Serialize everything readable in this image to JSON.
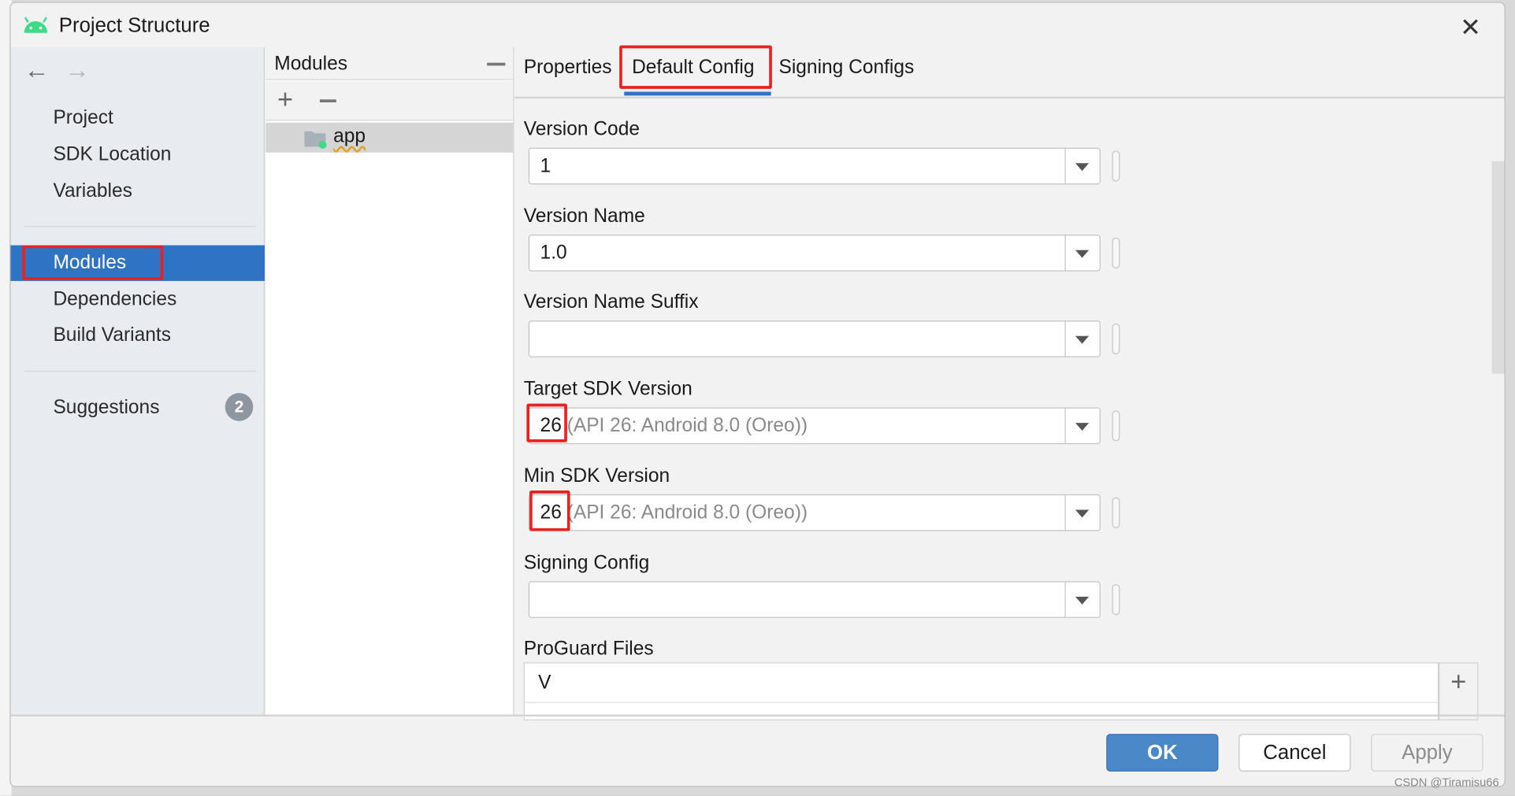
{
  "window": {
    "title": "Project Structure",
    "icon": "android-icon",
    "close_icon": "close-icon"
  },
  "nav": {
    "back_icon": "arrow-left-icon",
    "forward_icon": "arrow-right-icon"
  },
  "sidebar": {
    "items": [
      {
        "label": "Project"
      },
      {
        "label": "SDK Location"
      },
      {
        "label": "Variables"
      },
      {
        "label": "Modules",
        "selected": true
      },
      {
        "label": "Dependencies"
      },
      {
        "label": "Build Variants"
      },
      {
        "label": "Suggestions",
        "badge": "2"
      }
    ]
  },
  "modules": {
    "header": "Modules",
    "items": [
      {
        "label": "app",
        "icon": "module-folder-icon"
      }
    ]
  },
  "tabs": [
    {
      "label": "Properties"
    },
    {
      "label": "Default Config",
      "active": true
    },
    {
      "label": "Signing Configs"
    }
  ],
  "fields": [
    {
      "label": "Version Code",
      "value": "1",
      "hint": ""
    },
    {
      "label": "Version Name",
      "value": "1.0",
      "hint": ""
    },
    {
      "label": "Version Name Suffix",
      "value": "",
      "hint": ""
    },
    {
      "label": "Target SDK Version",
      "value": "26",
      "hint": " (API 26: Android 8.0 (Oreo))"
    },
    {
      "label": "Min SDK Version",
      "value": "26",
      "hint": " (API 26: Android 8.0 (Oreo))"
    },
    {
      "label": "Signing Config",
      "value": "",
      "hint": ""
    }
  ],
  "proguard": {
    "label": "ProGuard Files",
    "value": "V"
  },
  "buttons": {
    "ok": "OK",
    "cancel": "Cancel",
    "apply": "Apply"
  },
  "watermark": "CSDN @Tiramisu66",
  "colors": {
    "selection": "#2f74c4",
    "ok_button": "#4a88c7",
    "highlight": "#e8231f"
  }
}
